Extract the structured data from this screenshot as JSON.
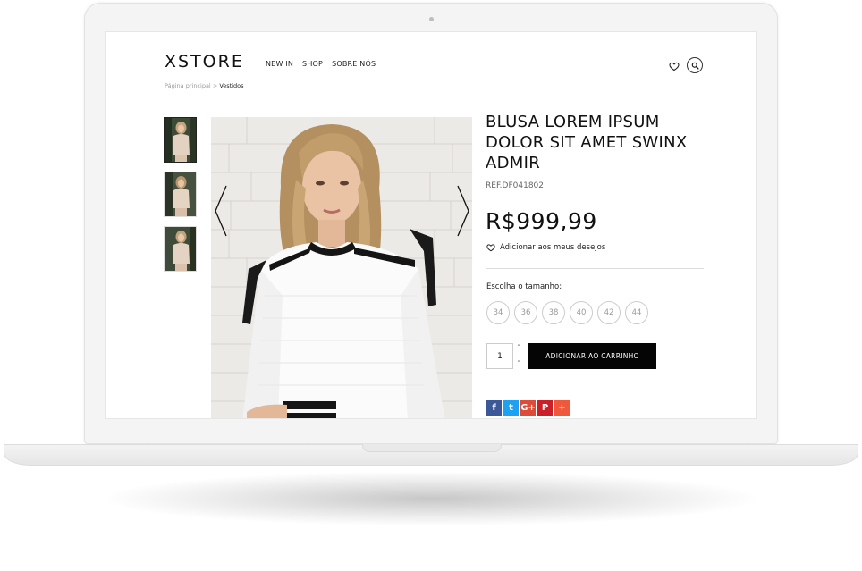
{
  "header": {
    "logo": "XSTORE",
    "nav": [
      "NEW IN",
      "SHOP",
      "SOBRE NÓS"
    ]
  },
  "breadcrumb": {
    "home": "Página principal",
    "separator": ">",
    "current": "Vestidos"
  },
  "product": {
    "title": "BLUSA LOREM IPSUM DOLOR SIT AMET SWINX ADMIR",
    "ref": "REF.DF041802",
    "price": "R$999,99",
    "wishlist_label": "Adicionar aos meus desejos",
    "size_label": "Escolha o tamanho:",
    "sizes": [
      "34",
      "36",
      "38",
      "40",
      "42",
      "44"
    ],
    "quantity": "1",
    "qty_up": "˄",
    "qty_down": "˅",
    "add_to_cart": "ADICIONAR AO CARRINHO"
  },
  "share": [
    {
      "glyph": "f",
      "color": "#3b5998"
    },
    {
      "glyph": "t",
      "color": "#1da1f2"
    },
    {
      "glyph": "G+",
      "color": "#dd4b39"
    },
    {
      "glyph": "P",
      "color": "#cb2027"
    },
    {
      "glyph": "+",
      "color": "#f0583c"
    }
  ],
  "icons": {
    "wishlist": "heart-icon",
    "search": "search-icon",
    "prev": "chevron-left-icon",
    "next": "chevron-right-icon"
  }
}
